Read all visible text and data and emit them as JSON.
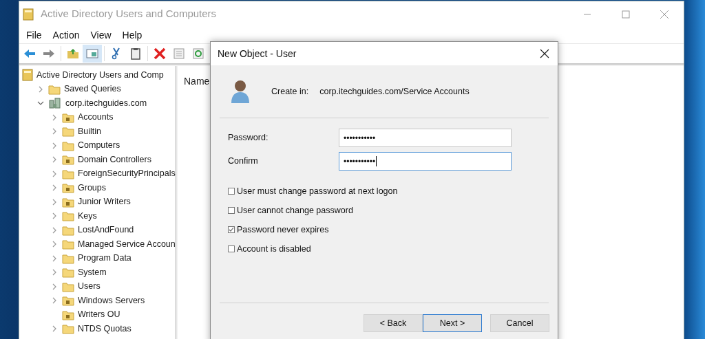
{
  "window": {
    "title": "Active Directory Users and Computers"
  },
  "menu": [
    "File",
    "Action",
    "View",
    "Help"
  ],
  "tree": {
    "label": "Active Directory Users and Comp",
    "kind": "console",
    "children": [
      {
        "label": "Saved Queries",
        "kind": "folder",
        "expanded": false
      },
      {
        "label": "corp.itechguides.com",
        "kind": "domain",
        "expanded": true,
        "children": [
          {
            "label": "Accounts",
            "kind": "ou",
            "expanded": false
          },
          {
            "label": "Builtin",
            "kind": "folder",
            "expanded": false
          },
          {
            "label": "Computers",
            "kind": "folder",
            "expanded": false
          },
          {
            "label": "Domain Controllers",
            "kind": "ou",
            "expanded": false
          },
          {
            "label": "ForeignSecurityPrincipals",
            "kind": "folder",
            "expanded": false
          },
          {
            "label": "Groups",
            "kind": "ou",
            "expanded": false
          },
          {
            "label": "Junior Writers",
            "kind": "ou",
            "expanded": false
          },
          {
            "label": "Keys",
            "kind": "folder",
            "expanded": false
          },
          {
            "label": "LostAndFound",
            "kind": "folder",
            "expanded": false
          },
          {
            "label": "Managed Service Accoun",
            "kind": "folder",
            "expanded": false
          },
          {
            "label": "Program Data",
            "kind": "folder",
            "expanded": false
          },
          {
            "label": "System",
            "kind": "folder",
            "expanded": false
          },
          {
            "label": "Users",
            "kind": "folder",
            "expanded": false
          },
          {
            "label": "Windows Servers",
            "kind": "ou",
            "expanded": false
          },
          {
            "label": "Writers OU",
            "kind": "ou"
          },
          {
            "label": "NTDS Quotas",
            "kind": "folder",
            "expanded": false
          }
        ]
      }
    ]
  },
  "list": {
    "columns": [
      "Name"
    ]
  },
  "dialog": {
    "title": "New Object - User",
    "create_in_label": "Create in:",
    "create_in_path": "corp.itechguides.com/Service Accounts",
    "fields": [
      {
        "label": "Password:",
        "value": "•••••••••••",
        "focused": false
      },
      {
        "label": "Confirm",
        "value": "•••••••••••",
        "focused": true
      }
    ],
    "options": [
      {
        "label": "User must change password at next logon",
        "checked": false
      },
      {
        "label": "User cannot change password",
        "checked": false
      },
      {
        "label": "Password never expires",
        "checked": true
      },
      {
        "label": "Account is disabled",
        "checked": false
      }
    ],
    "buttons": [
      {
        "label": "< Back",
        "default": false
      },
      {
        "label": "Next >",
        "default": true
      },
      {
        "label": "Cancel",
        "default": false
      }
    ]
  }
}
